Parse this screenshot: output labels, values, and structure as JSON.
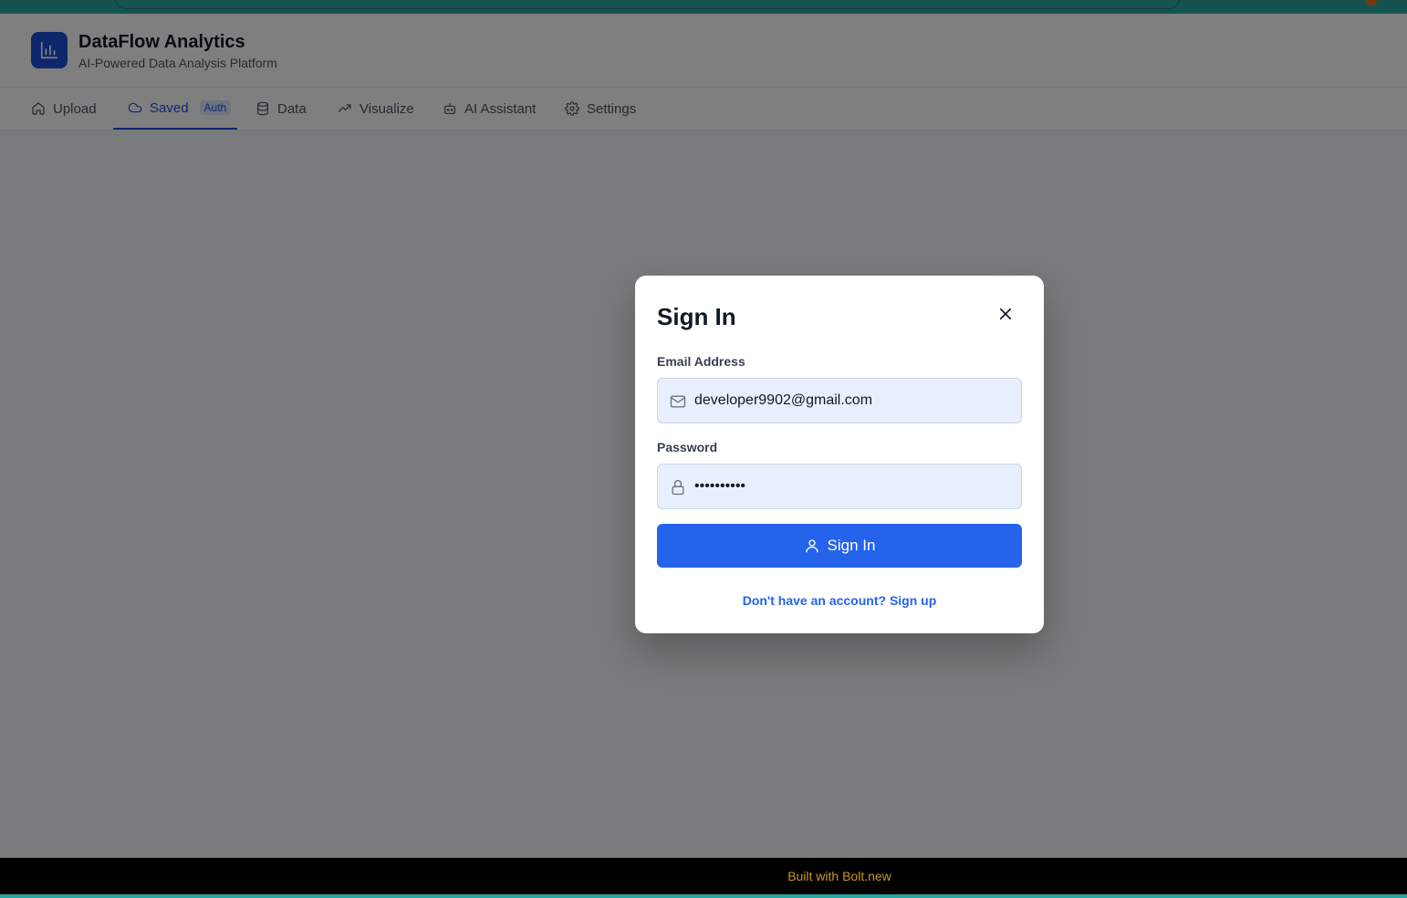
{
  "app": {
    "title": "DataFlow Analytics",
    "subtitle": "AI-Powered Data Analysis Platform",
    "logo_icon": "bar-chart-icon"
  },
  "nav": {
    "tabs": [
      {
        "label": "Upload",
        "icon": "home-icon"
      },
      {
        "label": "Saved",
        "icon": "cloud-icon",
        "badge": "Auth",
        "active": true
      },
      {
        "label": "Data",
        "icon": "database-icon"
      },
      {
        "label": "Visualize",
        "icon": "trending-up-icon"
      },
      {
        "label": "AI Assistant",
        "icon": "bot-icon"
      },
      {
        "label": "Settings",
        "icon": "gear-icon"
      }
    ]
  },
  "modal": {
    "title": "Sign In",
    "email_label": "Email Address",
    "email_value": "developer9902@gmail.com",
    "password_label": "Password",
    "password_value": "••••••••••",
    "submit_label": "Sign In",
    "signup_text": "Don't have an account? Sign up"
  },
  "footer": {
    "text": "Built with Bolt.new"
  },
  "colors": {
    "primary": "#2563eb",
    "brand": "#1d4ed8",
    "overlay": "rgba(0,0,0,0.5)",
    "footer_text": "#c9962b"
  }
}
